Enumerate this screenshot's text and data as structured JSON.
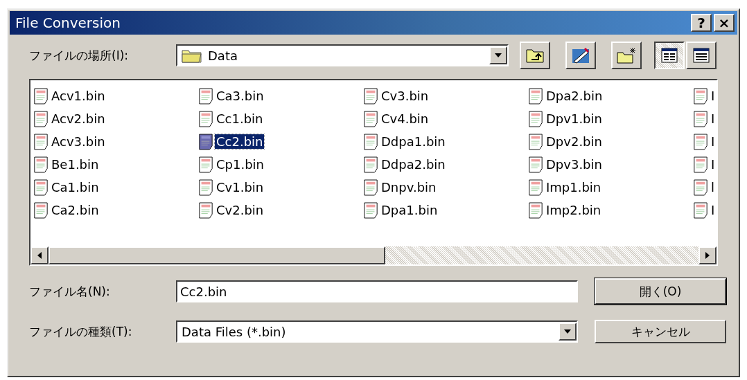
{
  "window": {
    "title": "File Conversion",
    "help": "?",
    "close": "×"
  },
  "location": {
    "label": "ファイルの場所(I):",
    "value": "Data"
  },
  "view_buttons": [
    {
      "kind": "list",
      "selected": true
    },
    {
      "kind": "details",
      "selected": false
    }
  ],
  "files": [
    {
      "name": "Acv1.bin",
      "selected": false
    },
    {
      "name": "Acv2.bin",
      "selected": false
    },
    {
      "name": "Acv3.bin",
      "selected": false
    },
    {
      "name": "Be1.bin",
      "selected": false
    },
    {
      "name": "Ca1.bin",
      "selected": false
    },
    {
      "name": "Ca2.bin",
      "selected": false
    },
    {
      "name": "Ca3.bin",
      "selected": false
    },
    {
      "name": "Cc1.bin",
      "selected": false
    },
    {
      "name": "Cc2.bin",
      "selected": true
    },
    {
      "name": "Cp1.bin",
      "selected": false
    },
    {
      "name": "Cv1.bin",
      "selected": false
    },
    {
      "name": "Cv2.bin",
      "selected": false
    },
    {
      "name": "Cv3.bin",
      "selected": false
    },
    {
      "name": "Cv4.bin",
      "selected": false
    },
    {
      "name": "Ddpa1.bin",
      "selected": false
    },
    {
      "name": "Ddpa2.bin",
      "selected": false
    },
    {
      "name": "Dnpv.bin",
      "selected": false
    },
    {
      "name": "Dpa1.bin",
      "selected": false
    },
    {
      "name": "Dpa2.bin",
      "selected": false
    },
    {
      "name": "Dpv1.bin",
      "selected": false
    },
    {
      "name": "Dpv2.bin",
      "selected": false
    },
    {
      "name": "Dpv3.bin",
      "selected": false
    },
    {
      "name": "Imp1.bin",
      "selected": false
    },
    {
      "name": "Imp2.bin",
      "selected": false
    },
    {
      "name": "I",
      "selected": false
    },
    {
      "name": "I",
      "selected": false
    },
    {
      "name": "I",
      "selected": false
    },
    {
      "name": "I",
      "selected": false
    },
    {
      "name": "l",
      "selected": false
    },
    {
      "name": "I",
      "selected": false
    }
  ],
  "file_name": {
    "label": "ファイル名(N):",
    "value": "Cc2.bin"
  },
  "file_type": {
    "label": "ファイルの種類(T):",
    "value": "Data Files (*.bin)"
  },
  "buttons": [
    {
      "label": "開く(O)",
      "kind": "default"
    },
    {
      "label": "キャンセル",
      "kind": "normal"
    }
  ]
}
